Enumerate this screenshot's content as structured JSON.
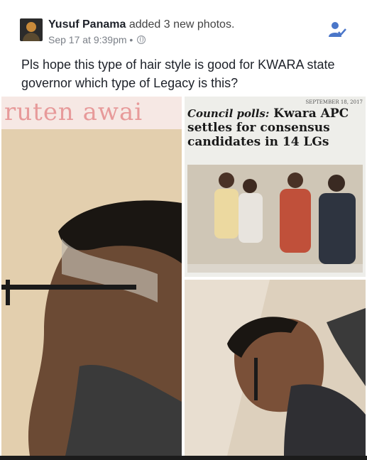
{
  "post": {
    "author": "Yusuf Panama",
    "action": " added 3 new photos.",
    "timestamp": "Sep 17 at 9:39pm",
    "separator": " • ",
    "text": "Pls hope this type of hair style is good for KWARA state governor which type of Legacy is this?"
  },
  "photos": {
    "photo1_headline_fragment": "ruten awai",
    "photo2": {
      "date": "SEPTEMBER 18, 2017",
      "kicker": "Council polls:",
      "headline_a": " Kwara APC",
      "headline_b": "settles for consensus",
      "headline_c": "candidates in 14 LGs"
    }
  },
  "colors": {
    "text": "#1d2129",
    "meta": "#7a7f87",
    "accent": "#4a76c9"
  },
  "icons": {
    "privacy": "globe-icon",
    "friend": "friend-icon"
  }
}
